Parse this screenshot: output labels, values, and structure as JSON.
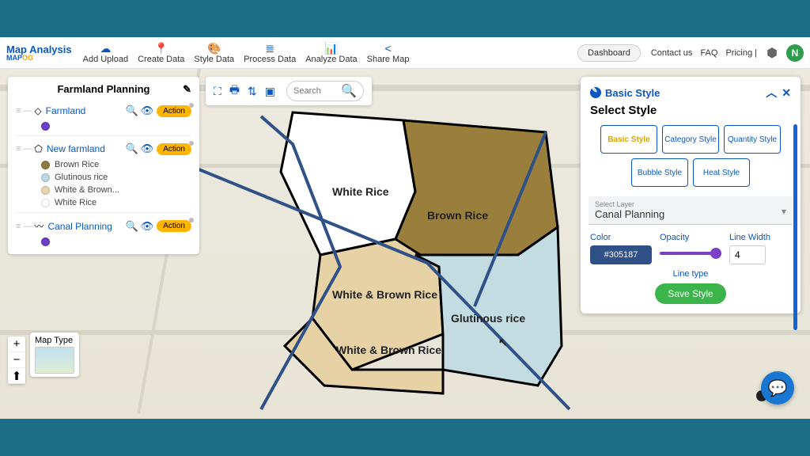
{
  "brand": {
    "line1": "Map Analysis",
    "line2a": "MAP",
    "line2b": "OG"
  },
  "nav": {
    "upload": "Add Upload",
    "create": "Create Data",
    "style": "Style Data",
    "process": "Process Data",
    "analyze": "Analyze Data",
    "share": "Share Map"
  },
  "top": {
    "dashboard": "Dashboard",
    "contact": "Contact us",
    "faq": "FAQ",
    "pricing": "Pricing |",
    "avatar": "N"
  },
  "maptb": {
    "search_ph": "Search"
  },
  "layers": {
    "title": "Farmland Planning",
    "items": [
      {
        "name": "Farmland",
        "type": "point",
        "swatches": [
          {
            "label": "",
            "color": "#6b3fc6"
          }
        ]
      },
      {
        "name": "New farmland",
        "type": "poly",
        "swatches": [
          {
            "label": "Brown Rice",
            "color": "#8f7a3f"
          },
          {
            "label": "Glutinous rice",
            "color": "#bcd7de"
          },
          {
            "label": "White & Brown...",
            "color": "#e7d6b1"
          },
          {
            "label": "White Rice",
            "color": "#ffffff"
          }
        ]
      },
      {
        "name": "Canal Planning",
        "type": "line",
        "swatches": [
          {
            "label": "",
            "color": "#6b3fc6"
          }
        ]
      }
    ],
    "action": "Action"
  },
  "maptype": {
    "label": "Map Type"
  },
  "style": {
    "bar": "Basic Style",
    "heading": "Select Style",
    "tiles": [
      "Basic Style",
      "Category Style",
      "Quantity Style",
      "Bubble Style",
      "Heat Style"
    ],
    "select_label": "Select Layer",
    "select_value": "Canal Planning",
    "color_label": "Color",
    "color_value": "#305187",
    "opacity_label": "Opacity",
    "linewidth_label": "Line Width",
    "linewidth_value": "4",
    "linetype_label": "Line type",
    "save": "Save Style"
  },
  "regions": {
    "white": "White Rice",
    "brown": "Brown Rice",
    "wb1": "White & Brown Rice",
    "wb2": "White & Brown Rice",
    "glut": "Glutinous rice"
  },
  "colors": {
    "white": "#ffffff",
    "brown": "#9a7e3b",
    "wb": "#e7d2a6",
    "glut": "#c3dce2",
    "canal": "#305187"
  }
}
